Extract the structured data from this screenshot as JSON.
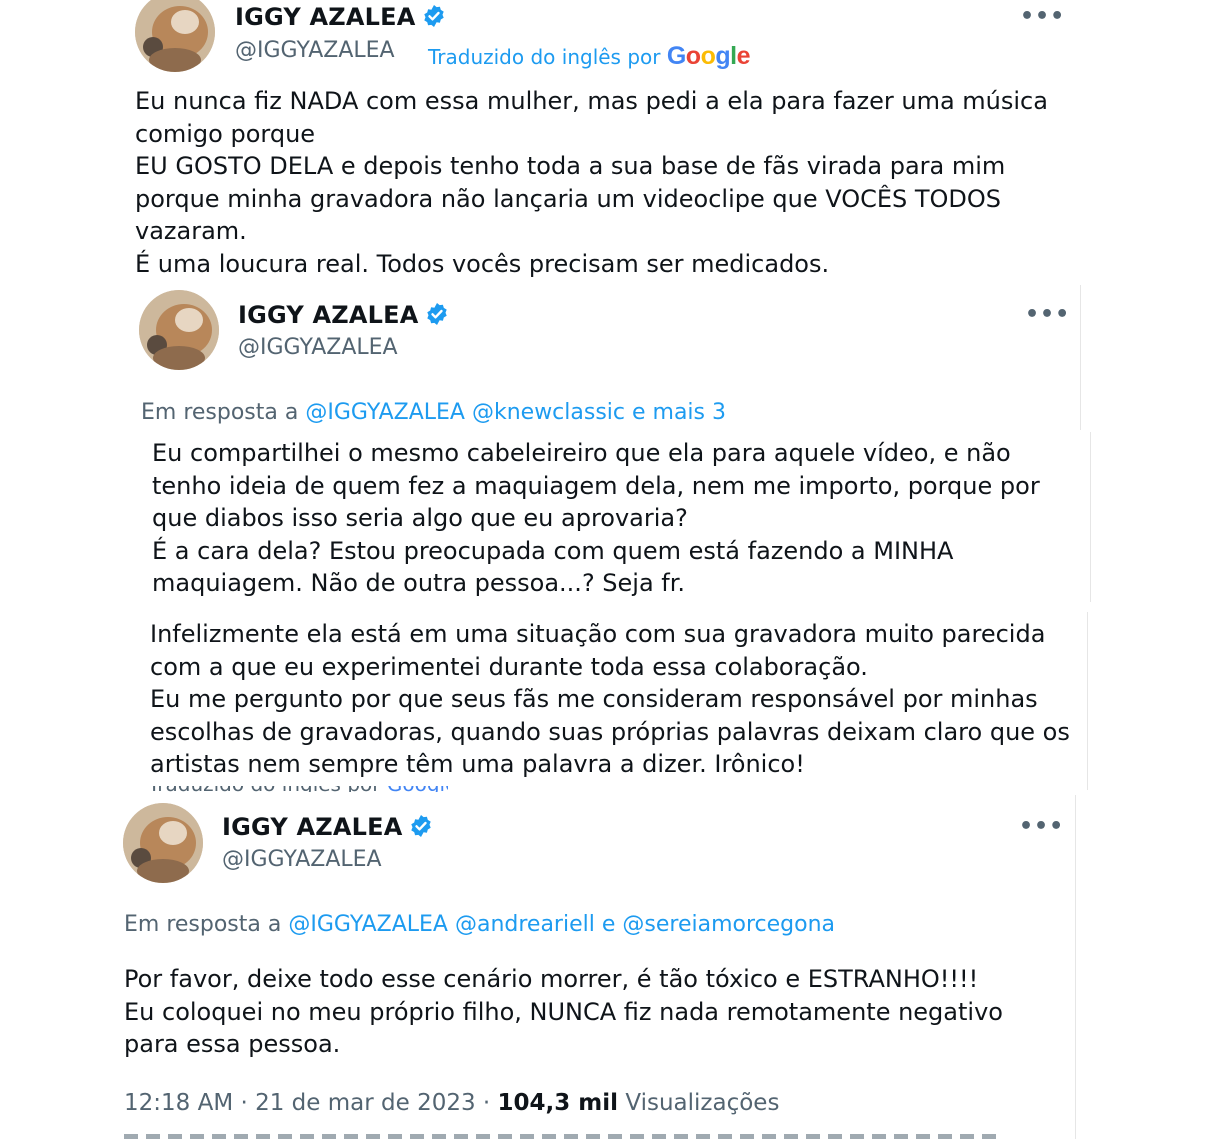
{
  "tweet1": {
    "name": "IGGY AZALEA",
    "handle": "@IGGYAZALEA",
    "translated_prefix": "Traduzido do inglês por",
    "translated_brand": "Google",
    "more": "•••",
    "text": "Eu nunca fiz NADA com essa mulher, mas pedi a ela para fazer uma música\ncomigo porque\nEU GOSTO DELA e depois tenho toda a sua base de fãs virada para mim\nporque minha gravadora não lançaria um videoclipe que VOCÊS TODOS\nvazaram.\nÉ uma loucura real. Todos vocês precisam ser medicados."
  },
  "tweet2": {
    "name": "IGGY AZALEA",
    "handle": "@IGGYAZALEA",
    "more": "•••",
    "reply_prefix": "Em resposta a",
    "reply_link1": "@IGGYAZALEA",
    "reply_link2": "@knewclassic e mais 3",
    "text1": "Eu compartilhei o mesmo cabeleireiro que ela para aquele vídeo, e não\ntenho ideia de quem fez a maquiagem dela, nem me importo, porque por\nque diabos isso seria algo que eu aprovaria?\nÉ a cara dela? Estou preocupada com quem está fazendo a MINHA\nmaquiagem. Não de outra pessoa...? Seja fr.",
    "text2": "Infelizmente ela está em uma situação com sua gravadora muito parecida\ncom a que eu experimentei durante toda essa colaboração.\nEu me pergunto por que seus fãs me consideram responsável por minhas\nescolhas de gravadoras, quando suas próprias palavras deixam claro que os\nartistas nem sempre têm uma palavra a dizer. Irônico!"
  },
  "tweet3": {
    "name": "IGGY AZALEA",
    "handle": "@IGGYAZALEA",
    "more": "•••",
    "reply_prefix": "Em resposta a",
    "reply_link1": "@IGGYAZALEA",
    "reply_link2": "@andreariell",
    "reply_and": "e",
    "reply_link3": "@sereiamorcegona",
    "text": "Por favor, deixe todo esse cenário morrer, é tão tóxico e ESTRANHO!!!!\nEu coloquei no meu próprio filho, NUNCA fiz nada remotamente negativo\npara essa pessoa.",
    "time": "12:18 AM · 21 de mar de 2023 ·",
    "views_count": "104,3 mil",
    "views_label": "Visualizações"
  },
  "colors": {
    "link": "#1d9bf0",
    "secondary": "#536471",
    "text": "#0f1419",
    "verified": "#1d9bf0"
  }
}
